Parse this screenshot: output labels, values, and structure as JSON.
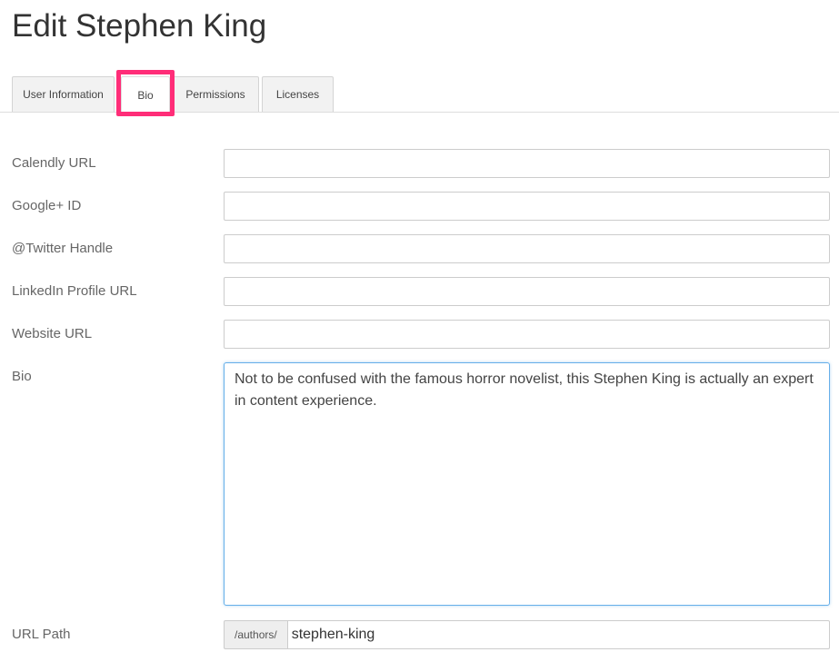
{
  "page": {
    "title": "Edit Stephen King"
  },
  "tabs": [
    {
      "label": "User Information",
      "active": false
    },
    {
      "label": "Bio",
      "active": true,
      "highlighted": true
    },
    {
      "label": "Permissions",
      "active": false
    },
    {
      "label": "Licenses",
      "active": false
    }
  ],
  "form": {
    "calendly": {
      "label": "Calendly URL",
      "value": ""
    },
    "google": {
      "label": "Google+ ID",
      "value": ""
    },
    "twitter": {
      "label": "@Twitter Handle",
      "value": ""
    },
    "linkedin": {
      "label": "LinkedIn Profile URL",
      "value": ""
    },
    "website": {
      "label": "Website URL",
      "value": ""
    },
    "bio": {
      "label": "Bio",
      "value": "Not to be confused with the famous horror novelist, this Stephen King is actually an expert in content experience."
    },
    "url_path": {
      "label": "URL Path",
      "prefix": "/authors/",
      "value": "stephen-king"
    }
  },
  "colors": {
    "highlight": "#ff2d78",
    "focus_border": "#66afe9"
  }
}
